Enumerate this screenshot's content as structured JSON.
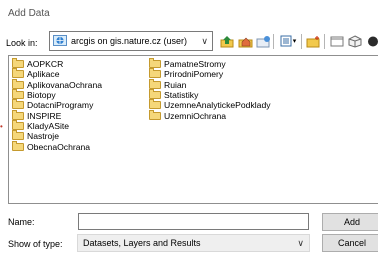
{
  "dialog": {
    "title": "Add Data"
  },
  "lookin": {
    "label": "Look in:",
    "value": "arcgis on gis.nature.cz (user)",
    "arrow": "∨"
  },
  "toolbar": {
    "icons": [
      "go-up-icon",
      "home-icon",
      "connect-folder-icon",
      "list-view-icon",
      "new-folder-icon",
      "catalog-icon",
      "cube-icon"
    ],
    "view_arrow": "▾"
  },
  "folders": {
    "left": [
      "AOPKCR",
      "Aplikace",
      "AplikovanaOchrana",
      "Biotopy",
      "DotacniProgramy",
      "INSPIRE",
      "KladyASite",
      "Nastroje",
      "ObecnaOchrana"
    ],
    "right": [
      "PamatneStromy",
      "PrirodniPomery",
      "Ruian",
      "Statistiky",
      "UzemneAnalytickePodklady",
      "UzemniOchrana"
    ]
  },
  "name_field": {
    "label": "Name:",
    "value": ""
  },
  "type_field": {
    "label": "Show of type:",
    "value": "Datasets, Layers and Results",
    "arrow": "∨"
  },
  "buttons": {
    "add": "Add",
    "cancel": "Cancel"
  },
  "colors": {
    "folder": "#f5d77a",
    "globe": "#2e7fd0"
  }
}
